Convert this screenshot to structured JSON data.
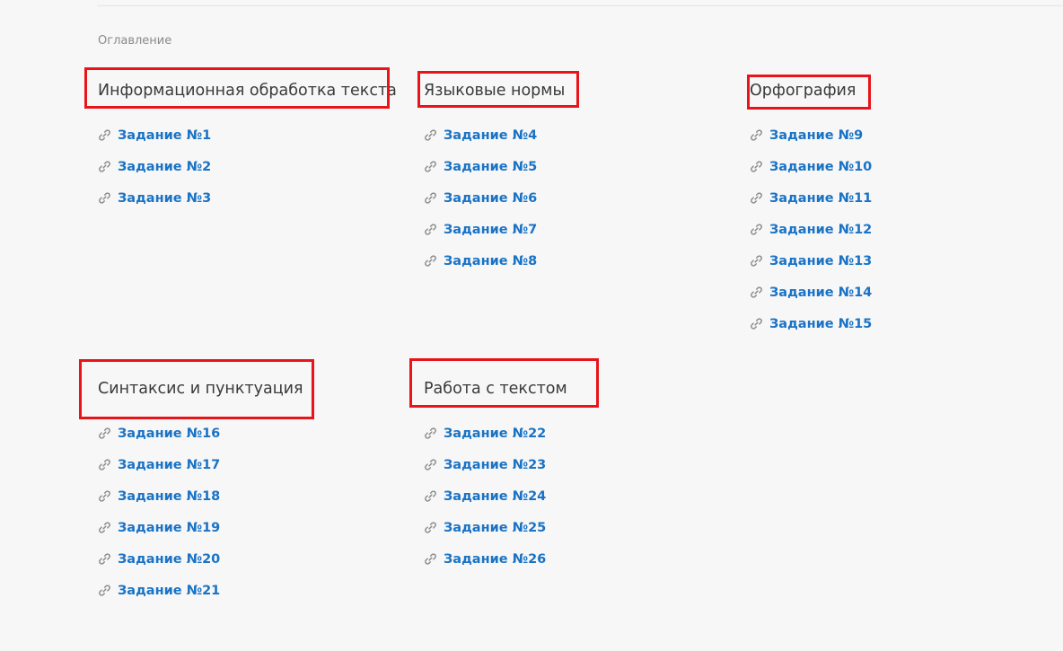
{
  "toc": {
    "title": "Оглавление",
    "sections": [
      {
        "title": "Информационная обработка текста",
        "links": [
          "Задание №1",
          "Задание №2",
          "Задание №3"
        ]
      },
      {
        "title": "Языковые нормы",
        "links": [
          "Задание №4",
          "Задание №5",
          "Задание №6",
          "Задание №7",
          "Задание №8"
        ]
      },
      {
        "title": "Орфография",
        "links": [
          "Задание №9",
          "Задание №10",
          "Задание №11",
          "Задание №12",
          "Задание №13",
          "Задание №14",
          "Задание №15"
        ]
      },
      {
        "title": "Синтаксис и пунктуация",
        "links": [
          "Задание №16",
          "Задание №17",
          "Задание №18",
          "Задание №19",
          "Задание №20",
          "Задание №21"
        ]
      },
      {
        "title": "Работа с текстом",
        "links": [
          "Задание №22",
          "Задание №23",
          "Задание №24",
          "Задание №25",
          "Задание №26"
        ]
      }
    ]
  },
  "icons": {
    "link": "link-chain-icon"
  },
  "colors": {
    "link": "#1a73c5",
    "heading": "#3a3a3a",
    "highlight": "#e8141a",
    "background": "#f7f7f7"
  }
}
